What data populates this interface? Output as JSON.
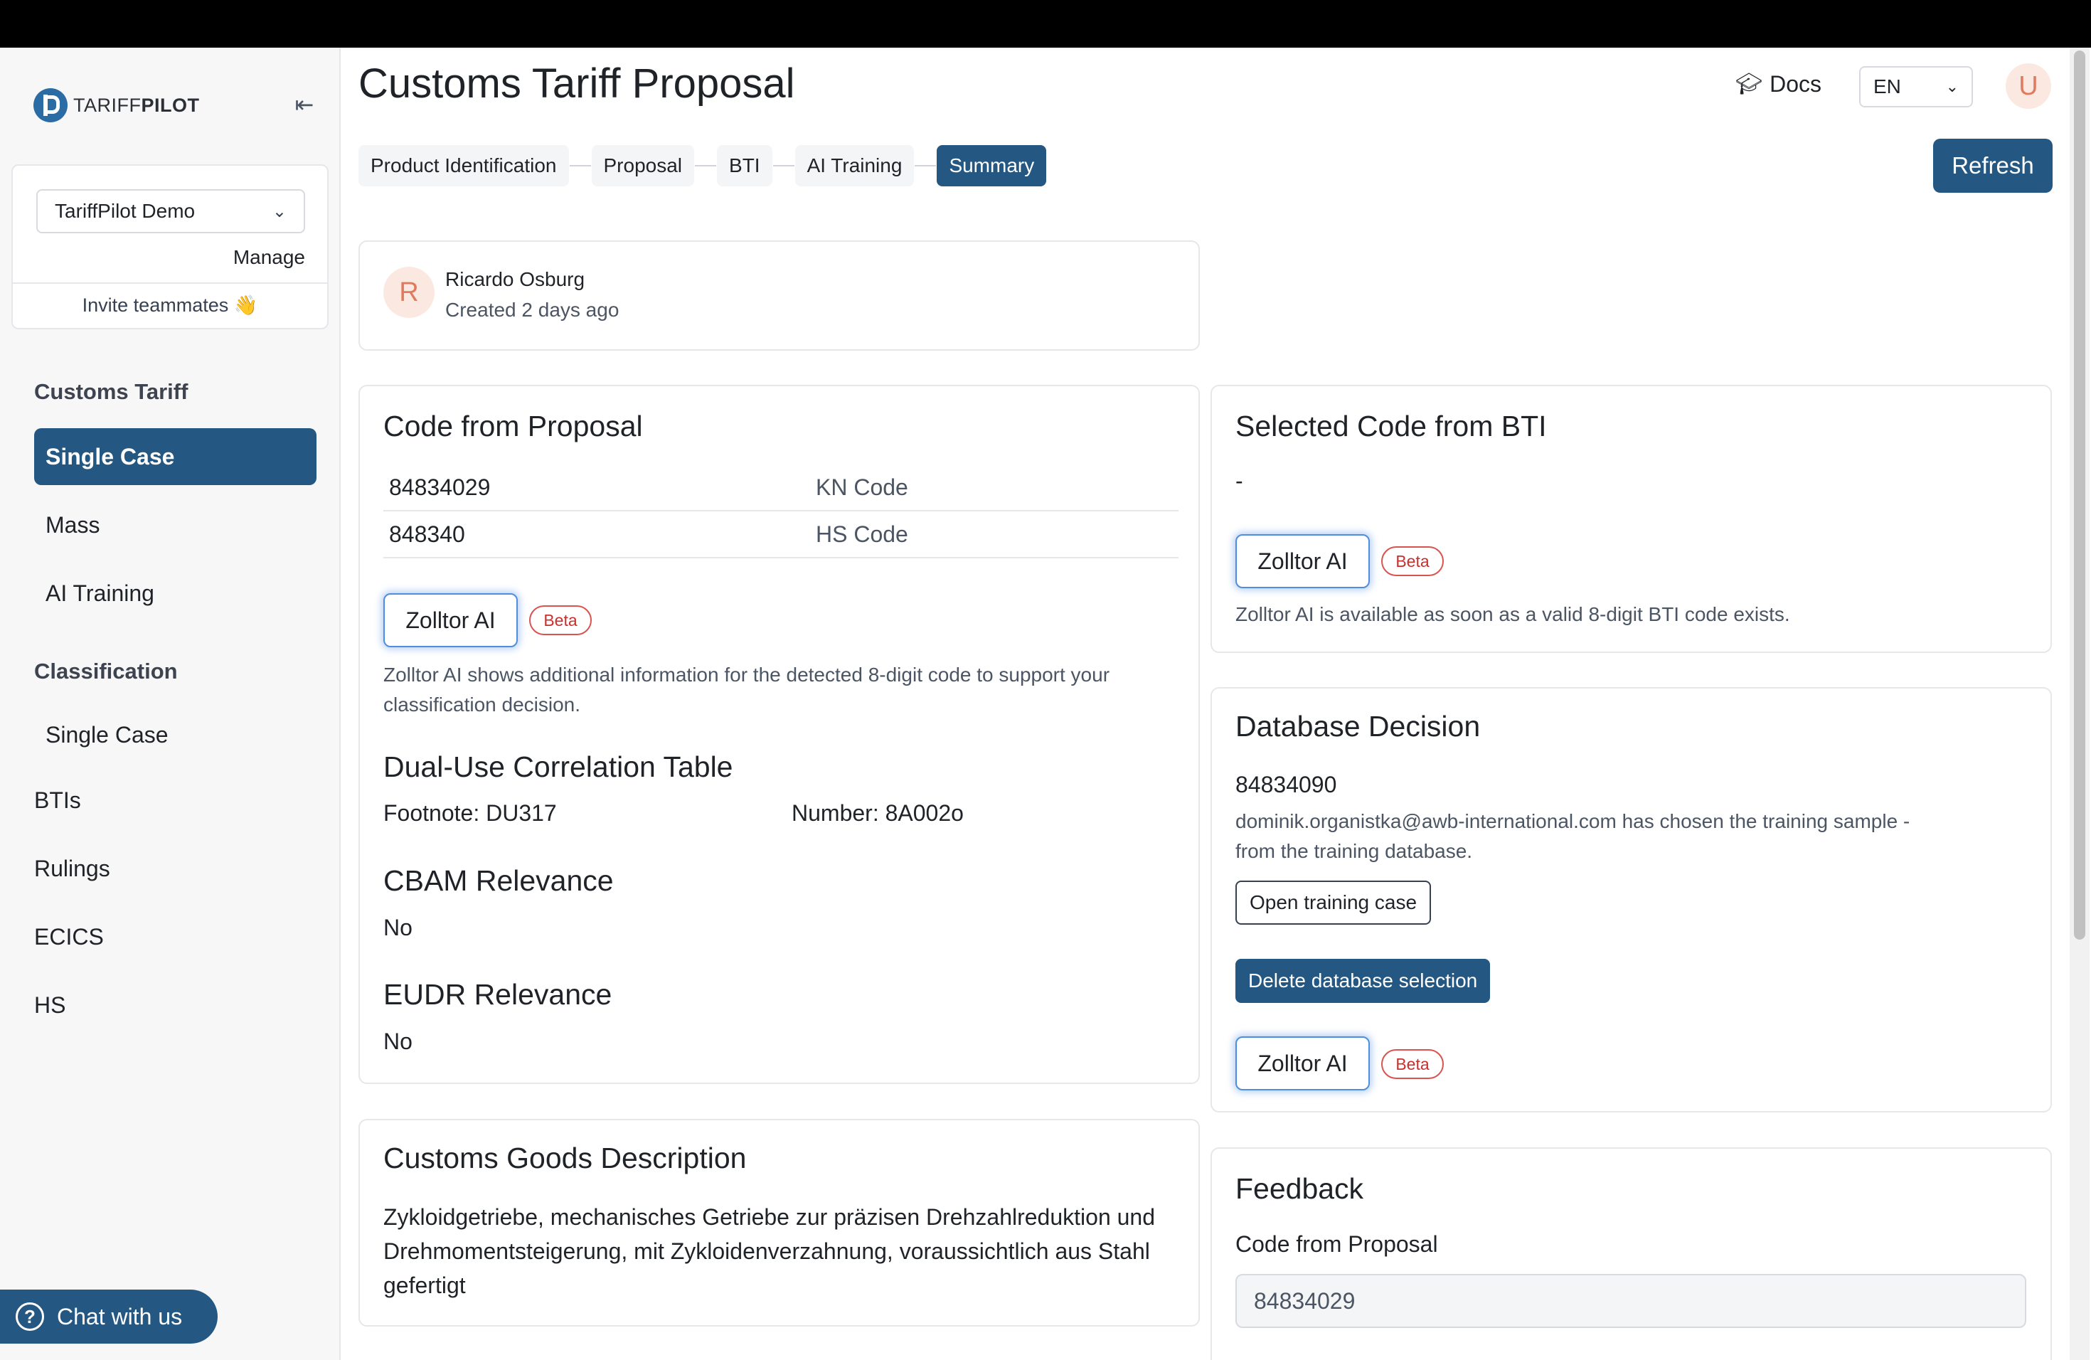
{
  "app": {
    "logo_prefix": "TARIFF",
    "logo_suffix": "PILOT"
  },
  "org": {
    "selected": "TariffPilot Demo",
    "manage": "Manage",
    "invite": "Invite teammates 👋"
  },
  "nav": {
    "customs_tariff": "Customs Tariff",
    "single_case": "Single Case",
    "mass": "Mass",
    "ai_training": "AI Training",
    "classification": "Classification",
    "classification_single_case": "Single Case",
    "btis": "BTIs",
    "rulings": "Rulings",
    "ecics": "ECICS",
    "hs": "HS"
  },
  "chat": {
    "label": "Chat with us"
  },
  "header": {
    "title": "Customs Tariff Proposal",
    "docs": "Docs",
    "language": "EN",
    "avatar_initial": "U",
    "refresh": "Refresh"
  },
  "steps": [
    "Product Identification",
    "Proposal",
    "BTI",
    "AI Training",
    "Summary"
  ],
  "author": {
    "initial": "R",
    "name": "Ricardo Osburg",
    "meta": "Created 2 days ago"
  },
  "proposal": {
    "title": "Code from Proposal",
    "rows": [
      {
        "value": "84834029",
        "label": "KN Code"
      },
      {
        "value": "848340",
        "label": "HS Code"
      }
    ],
    "ai_button": "Zolltor AI",
    "beta": "Beta",
    "ai_help": "Zolltor AI shows additional information for the detected 8-digit code to support your classification decision.",
    "dual_use_title": "Dual-Use Correlation Table",
    "footnote": "Footnote: DU317",
    "number": "Number: 8A002o",
    "cbam_title": "CBAM Relevance",
    "cbam_value": "No",
    "eudr_title": "EUDR Relevance",
    "eudr_value": "No"
  },
  "bti": {
    "title": "Selected Code from BTI",
    "value": "-",
    "ai_button": "Zolltor AI",
    "beta": "Beta",
    "ai_help": "Zolltor AI is available as soon as a valid 8-digit BTI code exists."
  },
  "database": {
    "title": "Database Decision",
    "code": "84834090",
    "message_line1": "dominik.organistka@awb-international.com has chosen the training sample -",
    "message_line2": "from the training database.",
    "open_button": "Open training case",
    "delete_button": "Delete database selection",
    "ai_button": "Zolltor AI",
    "beta": "Beta"
  },
  "goods": {
    "title": "Customs Goods Description",
    "text": "Zykloidgetriebe, mechanisches Getriebe zur präzisen Drehzahlreduktion und Drehmomentsteigerung, mit Zykloidenverzahnung, voraussichtlich aus Stahl gefertigt"
  },
  "feedback": {
    "title": "Feedback",
    "label": "Code from Proposal",
    "value": "84834029"
  }
}
